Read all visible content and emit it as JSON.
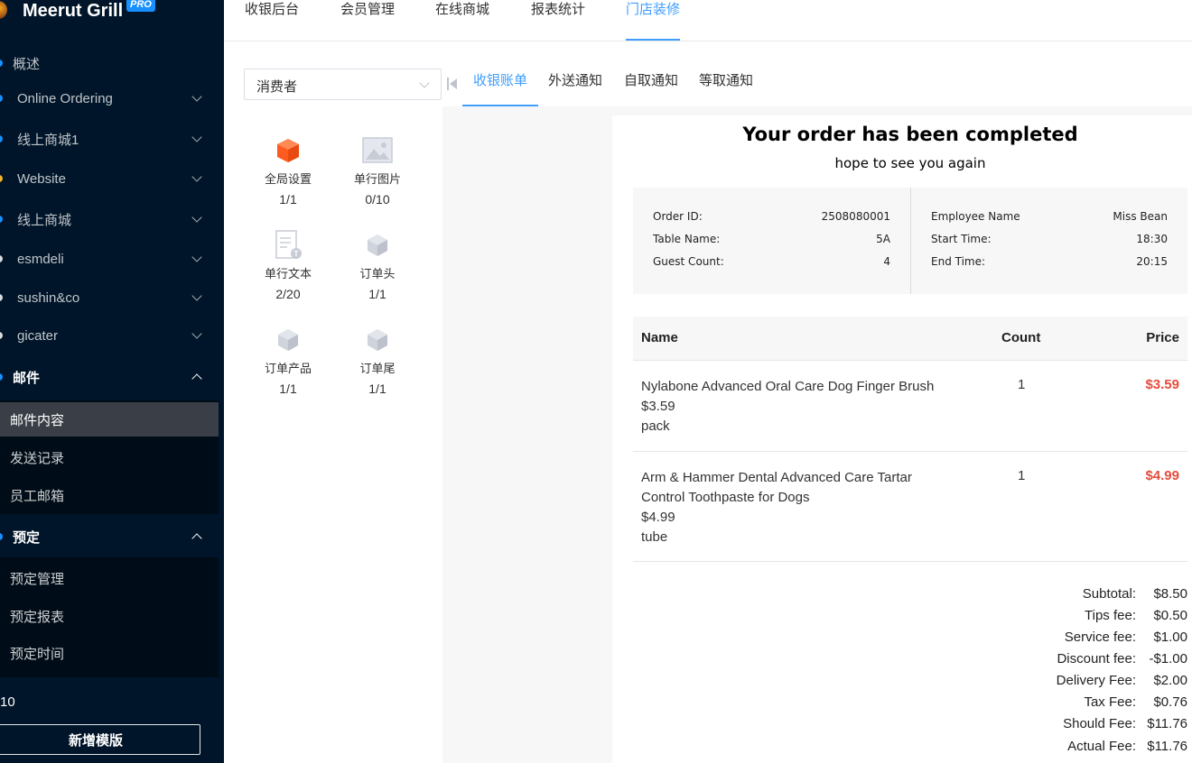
{
  "brand": {
    "name": "Meerut Grill",
    "badge": "PRO"
  },
  "sidebar": {
    "items": [
      {
        "label": "概述"
      },
      {
        "label": "Online Ordering"
      },
      {
        "label": "线上商城1"
      },
      {
        "label": "Website"
      },
      {
        "label": "线上商城"
      },
      {
        "label": "esmdeli"
      },
      {
        "label": "sushin&co"
      },
      {
        "label": "gicater"
      }
    ],
    "mail_group": {
      "label": "邮件",
      "items": [
        {
          "label": "邮件内容"
        },
        {
          "label": "发送记录"
        },
        {
          "label": "员工邮箱"
        }
      ]
    },
    "reserve_group": {
      "label": "预定",
      "items": [
        {
          "label": "预定管理"
        },
        {
          "label": "预定报表"
        },
        {
          "label": "预定时间"
        }
      ]
    },
    "count_text": "10",
    "new_template_button": "新增模版"
  },
  "topnav": {
    "items": [
      {
        "label": "收银后台"
      },
      {
        "label": "会员管理"
      },
      {
        "label": "在线商城"
      },
      {
        "label": "报表统计"
      },
      {
        "label": "门店装修"
      }
    ],
    "active": "门店装修"
  },
  "consumer_select": {
    "value": "消费者"
  },
  "tabs": {
    "items": [
      {
        "label": "收银账单"
      },
      {
        "label": "外送通知"
      },
      {
        "label": "自取通知"
      },
      {
        "label": "等取通知"
      }
    ],
    "active": "收银账单"
  },
  "components": [
    {
      "name": "全局设置",
      "count": "1/1",
      "icon": "cube-orange-icon"
    },
    {
      "name": "单行图片",
      "count": "0/10",
      "icon": "image-icon"
    },
    {
      "name": "单行文本",
      "count": "2/20",
      "icon": "text-document-icon"
    },
    {
      "name": "订单头",
      "count": "1/1",
      "icon": "cube-gray-icon"
    },
    {
      "name": "订单产品",
      "count": "1/1",
      "icon": "cube-gray-icon"
    },
    {
      "name": "订单尾",
      "count": "1/1",
      "icon": "cube-gray-icon"
    }
  ],
  "receipt": {
    "title": "Your order has been completed",
    "subtitle": "hope to see you again",
    "info_left": [
      {
        "label": "Order ID:",
        "value": "2508080001"
      },
      {
        "label": "Table Name:",
        "value": "5A"
      },
      {
        "label": "Guest Count:",
        "value": "4"
      }
    ],
    "info_right": [
      {
        "label": "Employee Name",
        "value": "Miss Bean"
      },
      {
        "label": "Start Time:",
        "value": "18:30"
      },
      {
        "label": "End Time:",
        "value": "20:15"
      }
    ],
    "columns": {
      "name": "Name",
      "count": "Count",
      "price": "Price"
    },
    "items": [
      {
        "name": "Nylabone Advanced Oral Care Dog Finger Brush",
        "unit_price": "$3.59",
        "unit": "pack",
        "count": "1",
        "price": "$3.59"
      },
      {
        "name_line1": "Arm & Hammer Dental Advanced Care Tartar",
        "name_line2": "Control Toothpaste for Dogs",
        "unit_price": "$4.99",
        "unit": "tube",
        "count": "1",
        "price": "$4.99"
      }
    ],
    "fees": [
      {
        "label": "Subtotal:",
        "value": "$8.50"
      },
      {
        "label": "Tips fee:",
        "value": "$0.50"
      },
      {
        "label": "Service fee:",
        "value": "$1.00"
      },
      {
        "label": "Discount fee:",
        "value": "-$1.00"
      },
      {
        "label": "Delivery Fee:",
        "value": "$2.00"
      },
      {
        "label": "Tax Fee:",
        "value": "$0.76"
      },
      {
        "label": "Should Fee:",
        "value": "$11.76"
      },
      {
        "label": "Actual Fee:",
        "value": "$11.76"
      }
    ],
    "price_color": "#e64c3c"
  },
  "colors": {
    "sidebar_bg": "#001529",
    "accent": "#409eff"
  }
}
